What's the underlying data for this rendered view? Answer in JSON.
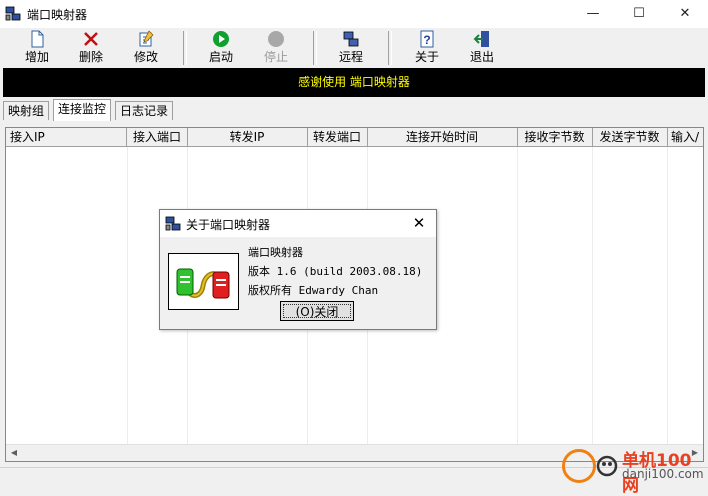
{
  "window": {
    "title": "端口映射器",
    "controls": [
      "—",
      "☐",
      "✕"
    ]
  },
  "toolbar": {
    "buttons": [
      {
        "id": "add",
        "label": "增加",
        "icon": "new-document-icon",
        "enabled": true
      },
      {
        "id": "delete",
        "label": "删除",
        "icon": "delete-x-icon",
        "enabled": true
      },
      {
        "id": "edit",
        "label": "修改",
        "icon": "edit-document-icon",
        "enabled": true
      },
      {
        "id": "start",
        "label": "启动",
        "icon": "play-icon",
        "enabled": true
      },
      {
        "id": "stop",
        "label": "停止",
        "icon": "stop-icon",
        "enabled": false
      },
      {
        "id": "remote",
        "label": "远程",
        "icon": "remote-computer-icon",
        "enabled": true
      },
      {
        "id": "about",
        "label": "关于",
        "icon": "help-icon",
        "enabled": true
      },
      {
        "id": "exit",
        "label": "退出",
        "icon": "exit-door-icon",
        "enabled": true
      }
    ]
  },
  "banner": {
    "text": "感谢使用 端口映射器",
    "color": "#ffff00",
    "background": "#000000"
  },
  "tabs": [
    {
      "label": "映射组",
      "active": false
    },
    {
      "label": "连接监控",
      "active": true
    },
    {
      "label": "日志记录",
      "active": false
    }
  ],
  "table": {
    "columns": [
      "接入IP",
      "接入端口",
      "转发IP",
      "转发端口",
      "连接开始时间",
      "接收字节数",
      "发送字节数",
      "输入/"
    ],
    "rows": []
  },
  "dialog": {
    "title": "关于端口映射器",
    "close": "✕",
    "app_name": "端口映射器",
    "version": "版本 1.6 (build 2003.08.18)",
    "copyright": "版权所有 Edwardy Chan",
    "ok_button": "(O)关闭"
  },
  "watermark": {
    "line1": "单机100网",
    "line2": "danji100.com",
    "color": "#e84020"
  }
}
